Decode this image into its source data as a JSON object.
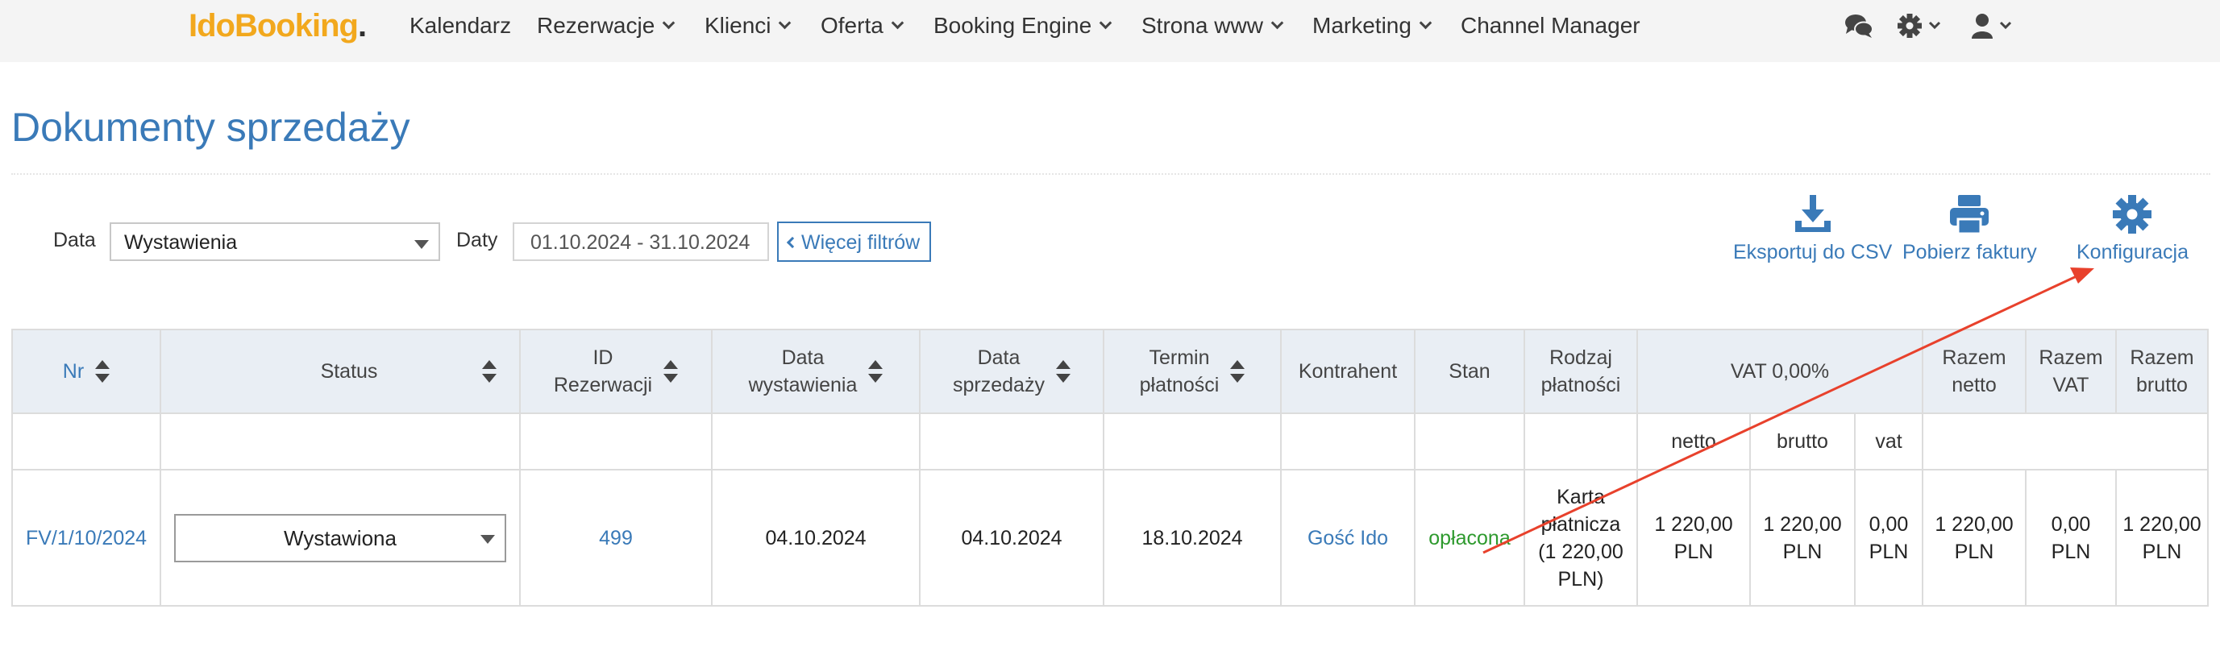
{
  "nav": {
    "logo": {
      "part1": "Ido",
      "part2": "Booking",
      "part3": "."
    },
    "items": [
      {
        "label": "Kalendarz"
      },
      {
        "label": "Rezerwacje"
      },
      {
        "label": "Klienci"
      },
      {
        "label": "Oferta"
      },
      {
        "label": "Booking Engine"
      },
      {
        "label": "Strona www"
      },
      {
        "label": "Marketing"
      },
      {
        "label": "Channel Manager"
      }
    ],
    "icons": [
      "chat-icon",
      "gear-icon",
      "user-icon"
    ]
  },
  "page": {
    "title": "Dokumenty sprzedaży"
  },
  "filters": {
    "date_label": "Data",
    "date_type_value": "Wystawienia",
    "range_label": "Daty",
    "range_value": "01.10.2024 - 31.10.2024",
    "more_filters": "Więcej filtrów"
  },
  "actions": {
    "export_csv": "Eksportuj do CSV",
    "download_invoices": "Pobierz faktury",
    "configuration": "Konfiguracja"
  },
  "table": {
    "headers": {
      "nr": "Nr",
      "status": "Status",
      "id_rez_1": "ID",
      "id_rez_2": "Rezerwacji",
      "data_wyst_1": "Data",
      "data_wyst_2": "wystawienia",
      "data_sprz_1": "Data",
      "data_sprz_2": "sprzedaży",
      "termin_1": "Termin",
      "termin_2": "płatności",
      "kontrahent": "Kontrahent",
      "stan": "Stan",
      "rodzaj_1": "Rodzaj",
      "rodzaj_2": "płatności",
      "vat": "VAT 0,00%",
      "razem_netto_1": "Razem",
      "razem_netto_2": "netto",
      "razem_vat_1": "Razem",
      "razem_vat_2": "VAT",
      "razem_brutto_1": "Razem",
      "razem_brutto_2": "brutto"
    },
    "subheaders": {
      "netto": "netto",
      "brutto": "brutto",
      "vat": "vat"
    },
    "rows": [
      {
        "nr": "FV/1/10/2024",
        "status": "Wystawiona",
        "id_rez": "499",
        "data_wyst": "04.10.2024",
        "data_sprz": "04.10.2024",
        "termin": "18.10.2024",
        "kontrahent": "Gość Ido",
        "stan": "opłacona",
        "rodzaj_1": "Karta",
        "rodzaj_2": "płatnicza",
        "rodzaj_3": "(1 220,00",
        "rodzaj_4": "PLN)",
        "vat_netto_1": "1 220,00",
        "vat_netto_2": "PLN",
        "vat_brutto_1": "1 220,00",
        "vat_brutto_2": "PLN",
        "vat_vat_1": "0,00",
        "vat_vat_2": "PLN",
        "razem_netto_1": "1 220,00",
        "razem_netto_2": "PLN",
        "razem_vat_1": "0,00",
        "razem_vat_2": "PLN",
        "razem_brutto_1": "1 220,00",
        "razem_brutto_2": "PLN"
      }
    ]
  },
  "colors": {
    "accent": "#3a7ab8",
    "logo": "#f2a81d",
    "paid": "#2e9a2e",
    "annotation": "#e8412c"
  }
}
